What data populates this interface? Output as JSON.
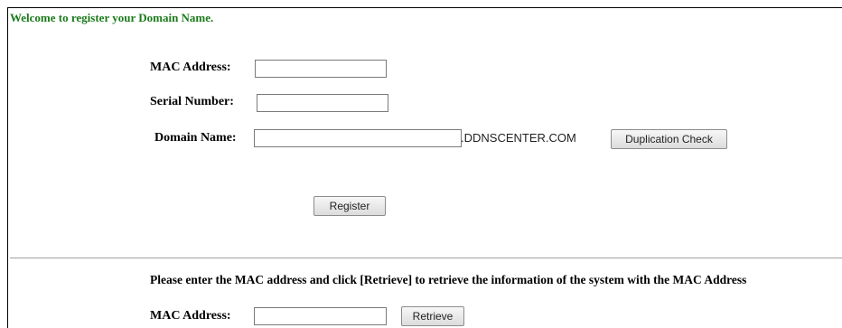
{
  "registration": {
    "welcome_text": "Welcome to register your Domain Name.",
    "mac_label": "MAC Address:",
    "mac_value": "",
    "serial_label": "Serial Number:",
    "serial_value": "",
    "domain_label": "Domain Name:",
    "domain_value": "",
    "domain_suffix": ".DDNSCENTER.COM",
    "duplication_check_label": "Duplication Check",
    "register_label": "Register"
  },
  "retrieve": {
    "instruction_text": "Please enter the MAC address and click [Retrieve] to retrieve the information of the system with the MAC Address",
    "mac_label": "MAC Address:",
    "mac_value": "",
    "retrieve_label": "Retrieve"
  },
  "colors": {
    "welcome_text": "#1a7a1a",
    "frame_border": "#000000",
    "divider": "#a0a0a0"
  }
}
